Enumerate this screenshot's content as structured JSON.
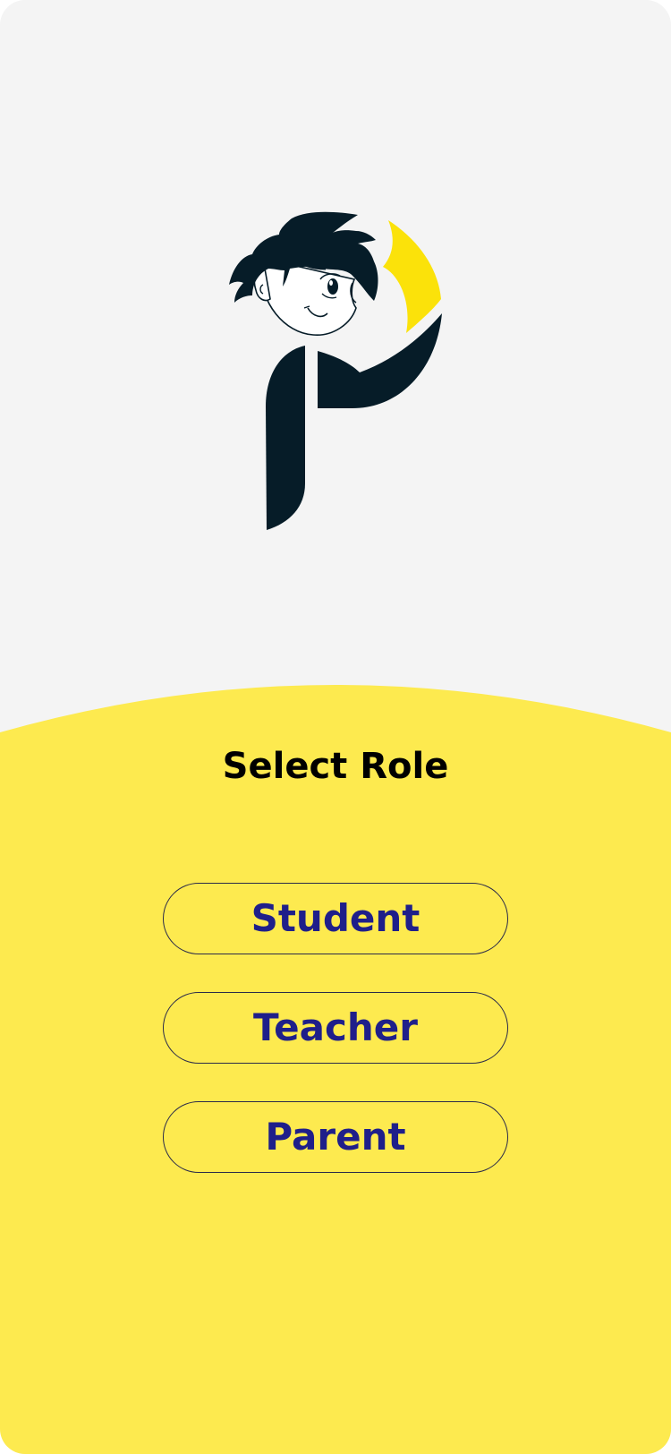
{
  "colors": {
    "background": "#f4f4f4",
    "sheet": "#fdea4f",
    "title_text": "#000000",
    "button_text": "#1f1f8a",
    "button_border": "#2a2a4a",
    "logo_dark": "#061c28",
    "logo_accent": "#fbe20a"
  },
  "icons": {
    "logo": "boy-letter-p-logo-icon"
  },
  "screen": {
    "title": "Select Role"
  },
  "roles": [
    {
      "label": "Student"
    },
    {
      "label": "Teacher"
    },
    {
      "label": "Parent"
    }
  ]
}
